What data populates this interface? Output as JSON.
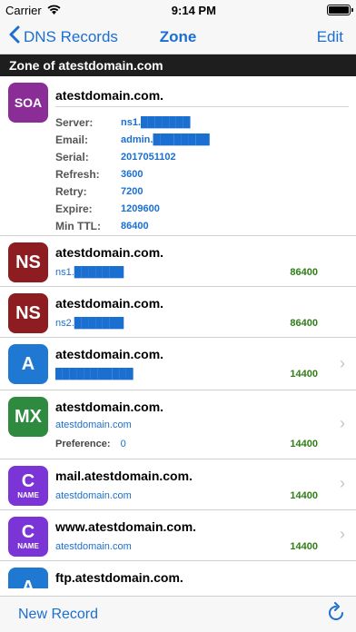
{
  "status": {
    "carrier": "Carrier",
    "time": "9:14 PM"
  },
  "nav": {
    "back_label": "DNS Records",
    "title": "Zone",
    "edit_label": "Edit"
  },
  "section": {
    "header": "Zone of atestdomain.com"
  },
  "soa": {
    "badge": "SOA",
    "name": "atestdomain.com.",
    "fields": [
      {
        "label": "Server:",
        "value": "ns1.███████"
      },
      {
        "label": "Email:",
        "value": "admin.████████"
      },
      {
        "label": "Serial:",
        "value": "2017051102"
      },
      {
        "label": "Refresh:",
        "value": "3600"
      },
      {
        "label": "Retry:",
        "value": "7200"
      },
      {
        "label": "Expire:",
        "value": "1209600"
      },
      {
        "label": "Min TTL:",
        "value": "86400"
      }
    ]
  },
  "records": [
    {
      "badge": "NS",
      "name": "atestdomain.com.",
      "value": "ns1.███████",
      "ttl": "86400"
    },
    {
      "badge": "NS",
      "name": "atestdomain.com.",
      "value": "ns2.███████",
      "ttl": "86400"
    },
    {
      "badge": "A",
      "name": "atestdomain.com.",
      "value": "███████████",
      "ttl": "14400"
    },
    {
      "badge": "MX",
      "name": "atestdomain.com.",
      "value": "atestdomain.com",
      "pref_label": "Preference:",
      "pref_value": "0",
      "ttl": "14400"
    },
    {
      "badge": "C",
      "badge_sub": "NAME",
      "name": "mail.atestdomain.com.",
      "value": "atestdomain.com",
      "ttl": "14400"
    },
    {
      "badge": "C",
      "badge_sub": "NAME",
      "name": "www.atestdomain.com.",
      "value": "atestdomain.com",
      "ttl": "14400"
    },
    {
      "badge": "A",
      "name": "ftp.atestdomain.com."
    }
  ],
  "toolbar": {
    "new_record_label": "New Record"
  },
  "colors": {
    "soa": "#8b2d97",
    "ns": "#8d1d20",
    "a": "#1f78d2",
    "mx": "#2d8a3e",
    "cname": "#7b35d6",
    "accent": "#1a6fd1",
    "ttl": "#2e7d16"
  },
  "icons": {
    "wifi": "wifi-icon",
    "battery": "battery-icon",
    "back": "chevron-left-icon",
    "chevron": "chevron-right-icon",
    "refresh": "refresh-icon"
  }
}
